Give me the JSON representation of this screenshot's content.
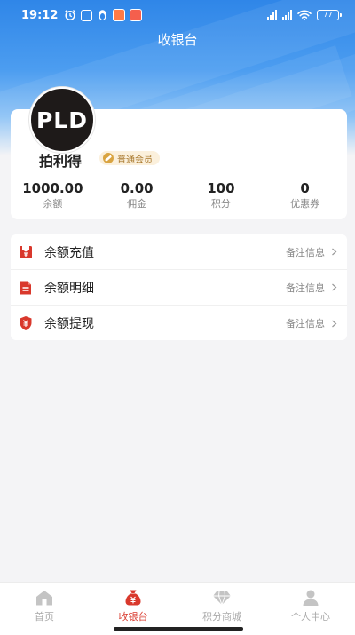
{
  "status_bar": {
    "time": "19:12",
    "battery": "77"
  },
  "header": {
    "title": "收银台"
  },
  "profile": {
    "avatar_text": "PLD",
    "name": "拍利得",
    "member_level": "普通会员"
  },
  "stats": [
    {
      "value": "1000.00",
      "label": "余额"
    },
    {
      "value": "0.00",
      "label": "佣金"
    },
    {
      "value": "100",
      "label": "积分"
    },
    {
      "value": "0",
      "label": "优惠券"
    }
  ],
  "menu": [
    {
      "label": "余额充值",
      "note": "备注信息",
      "icon": "recharge-icon"
    },
    {
      "label": "余额明细",
      "note": "备注信息",
      "icon": "document-icon"
    },
    {
      "label": "余额提现",
      "note": "备注信息",
      "icon": "shield-yuan-icon"
    }
  ],
  "tabs": [
    {
      "label": "首页",
      "icon": "home-icon",
      "active": false
    },
    {
      "label": "收银台",
      "icon": "money-bag-icon",
      "active": true
    },
    {
      "label": "积分商城",
      "icon": "diamond-icon",
      "active": false
    },
    {
      "label": "个人中心",
      "icon": "person-icon",
      "active": false
    }
  ],
  "colors": {
    "brand_blue": "#2f86e8",
    "accent_red": "#d9382c",
    "badge_gold": "#d9a441"
  }
}
